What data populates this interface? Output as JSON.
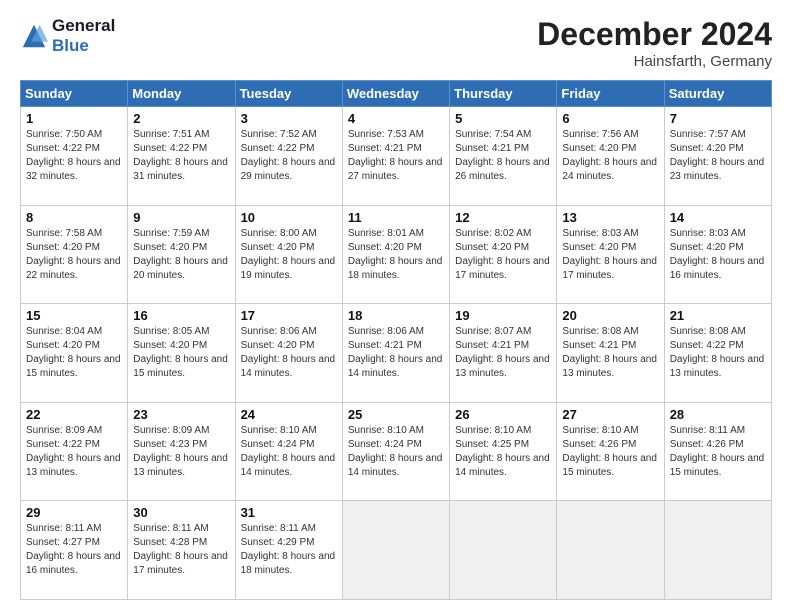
{
  "header": {
    "logo_line1": "General",
    "logo_line2": "Blue",
    "month_title": "December 2024",
    "location": "Hainsfarth, Germany"
  },
  "weekdays": [
    "Sunday",
    "Monday",
    "Tuesday",
    "Wednesday",
    "Thursday",
    "Friday",
    "Saturday"
  ],
  "weeks": [
    [
      {
        "day": "1",
        "sunrise": "7:50 AM",
        "sunset": "4:22 PM",
        "daylight": "8 hours and 32 minutes."
      },
      {
        "day": "2",
        "sunrise": "7:51 AM",
        "sunset": "4:22 PM",
        "daylight": "8 hours and 31 minutes."
      },
      {
        "day": "3",
        "sunrise": "7:52 AM",
        "sunset": "4:22 PM",
        "daylight": "8 hours and 29 minutes."
      },
      {
        "day": "4",
        "sunrise": "7:53 AM",
        "sunset": "4:21 PM",
        "daylight": "8 hours and 27 minutes."
      },
      {
        "day": "5",
        "sunrise": "7:54 AM",
        "sunset": "4:21 PM",
        "daylight": "8 hours and 26 minutes."
      },
      {
        "day": "6",
        "sunrise": "7:56 AM",
        "sunset": "4:20 PM",
        "daylight": "8 hours and 24 minutes."
      },
      {
        "day": "7",
        "sunrise": "7:57 AM",
        "sunset": "4:20 PM",
        "daylight": "8 hours and 23 minutes."
      }
    ],
    [
      {
        "day": "8",
        "sunrise": "7:58 AM",
        "sunset": "4:20 PM",
        "daylight": "8 hours and 22 minutes."
      },
      {
        "day": "9",
        "sunrise": "7:59 AM",
        "sunset": "4:20 PM",
        "daylight": "8 hours and 20 minutes."
      },
      {
        "day": "10",
        "sunrise": "8:00 AM",
        "sunset": "4:20 PM",
        "daylight": "8 hours and 19 minutes."
      },
      {
        "day": "11",
        "sunrise": "8:01 AM",
        "sunset": "4:20 PM",
        "daylight": "8 hours and 18 minutes."
      },
      {
        "day": "12",
        "sunrise": "8:02 AM",
        "sunset": "4:20 PM",
        "daylight": "8 hours and 17 minutes."
      },
      {
        "day": "13",
        "sunrise": "8:03 AM",
        "sunset": "4:20 PM",
        "daylight": "8 hours and 17 minutes."
      },
      {
        "day": "14",
        "sunrise": "8:03 AM",
        "sunset": "4:20 PM",
        "daylight": "8 hours and 16 minutes."
      }
    ],
    [
      {
        "day": "15",
        "sunrise": "8:04 AM",
        "sunset": "4:20 PM",
        "daylight": "8 hours and 15 minutes."
      },
      {
        "day": "16",
        "sunrise": "8:05 AM",
        "sunset": "4:20 PM",
        "daylight": "8 hours and 15 minutes."
      },
      {
        "day": "17",
        "sunrise": "8:06 AM",
        "sunset": "4:20 PM",
        "daylight": "8 hours and 14 minutes."
      },
      {
        "day": "18",
        "sunrise": "8:06 AM",
        "sunset": "4:21 PM",
        "daylight": "8 hours and 14 minutes."
      },
      {
        "day": "19",
        "sunrise": "8:07 AM",
        "sunset": "4:21 PM",
        "daylight": "8 hours and 13 minutes."
      },
      {
        "day": "20",
        "sunrise": "8:08 AM",
        "sunset": "4:21 PM",
        "daylight": "8 hours and 13 minutes."
      },
      {
        "day": "21",
        "sunrise": "8:08 AM",
        "sunset": "4:22 PM",
        "daylight": "8 hours and 13 minutes."
      }
    ],
    [
      {
        "day": "22",
        "sunrise": "8:09 AM",
        "sunset": "4:22 PM",
        "daylight": "8 hours and 13 minutes."
      },
      {
        "day": "23",
        "sunrise": "8:09 AM",
        "sunset": "4:23 PM",
        "daylight": "8 hours and 13 minutes."
      },
      {
        "day": "24",
        "sunrise": "8:10 AM",
        "sunset": "4:24 PM",
        "daylight": "8 hours and 14 minutes."
      },
      {
        "day": "25",
        "sunrise": "8:10 AM",
        "sunset": "4:24 PM",
        "daylight": "8 hours and 14 minutes."
      },
      {
        "day": "26",
        "sunrise": "8:10 AM",
        "sunset": "4:25 PM",
        "daylight": "8 hours and 14 minutes."
      },
      {
        "day": "27",
        "sunrise": "8:10 AM",
        "sunset": "4:26 PM",
        "daylight": "8 hours and 15 minutes."
      },
      {
        "day": "28",
        "sunrise": "8:11 AM",
        "sunset": "4:26 PM",
        "daylight": "8 hours and 15 minutes."
      }
    ],
    [
      {
        "day": "29",
        "sunrise": "8:11 AM",
        "sunset": "4:27 PM",
        "daylight": "8 hours and 16 minutes."
      },
      {
        "day": "30",
        "sunrise": "8:11 AM",
        "sunset": "4:28 PM",
        "daylight": "8 hours and 17 minutes."
      },
      {
        "day": "31",
        "sunrise": "8:11 AM",
        "sunset": "4:29 PM",
        "daylight": "8 hours and 18 minutes."
      },
      null,
      null,
      null,
      null
    ]
  ]
}
